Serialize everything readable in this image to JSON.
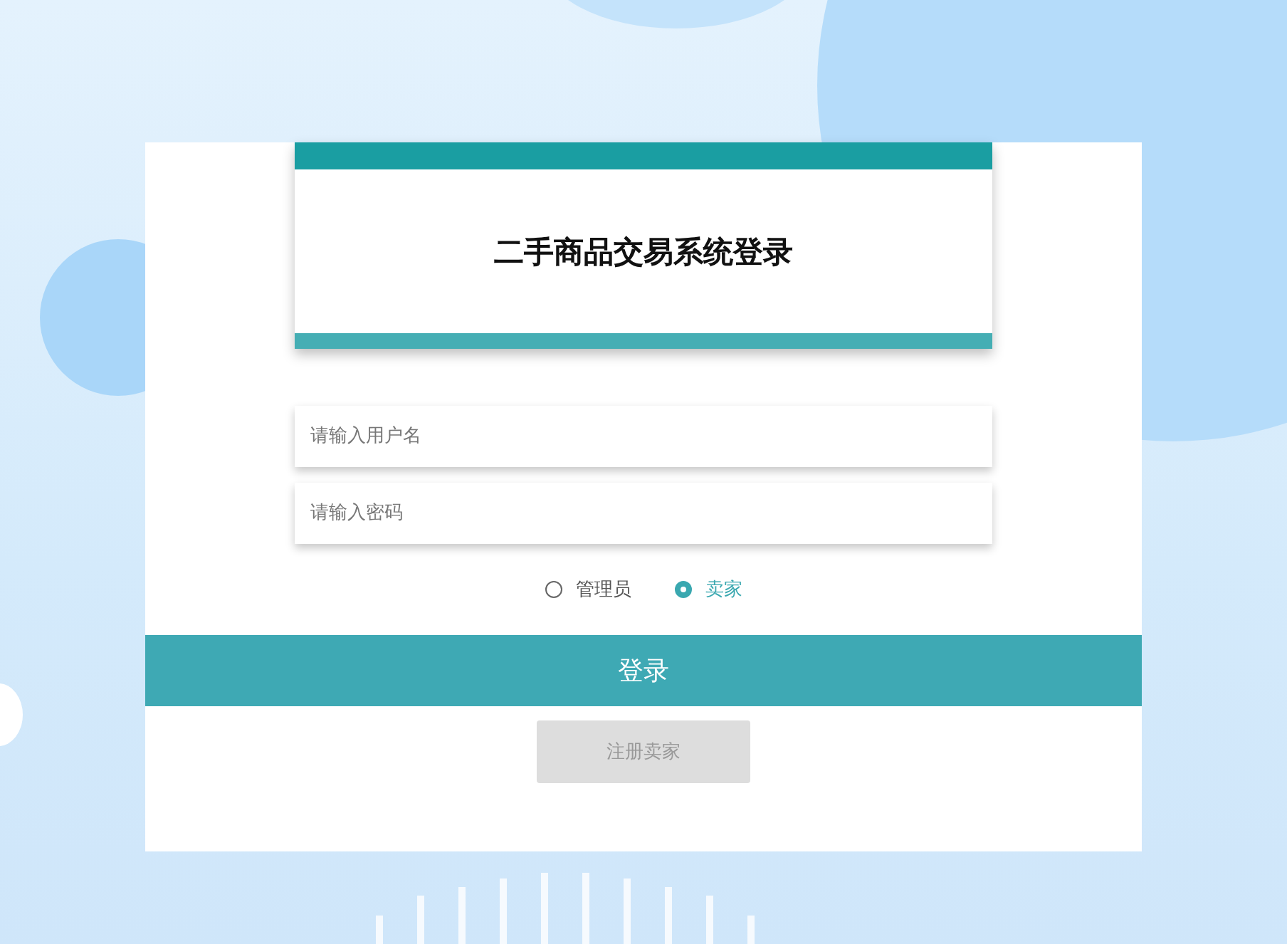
{
  "header": {
    "title": "二手商品交易系统登录"
  },
  "fields": [
    {
      "placeholder": "请输入用户名"
    },
    {
      "placeholder": "请输入密码"
    }
  ],
  "roles": [
    {
      "label": "管理员",
      "selected": false
    },
    {
      "label": "卖家",
      "selected": true
    }
  ],
  "login_button": "登录",
  "register_button": "注册卖家"
}
